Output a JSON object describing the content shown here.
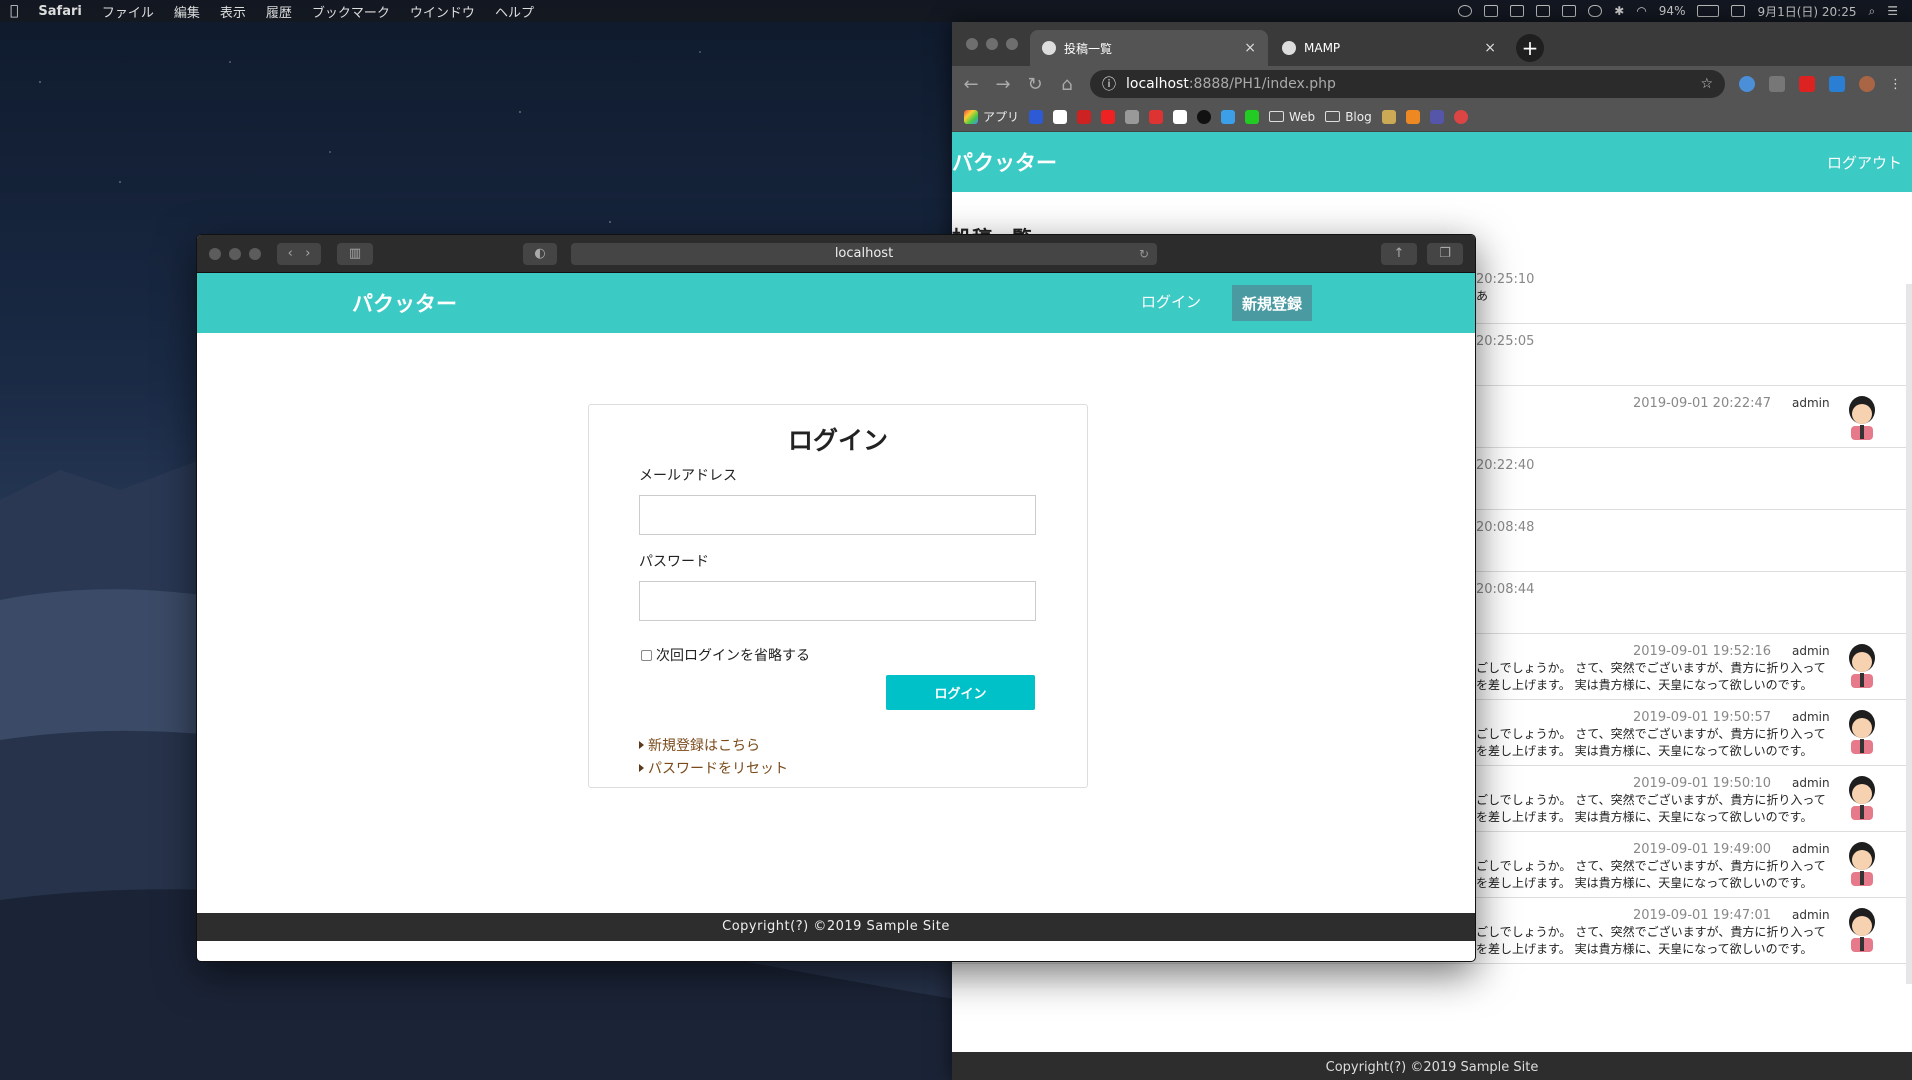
{
  "menubar": {
    "app": "Safari",
    "items": [
      "ファイル",
      "編集",
      "表示",
      "履歴",
      "ブックマーク",
      "ウインドウ",
      "ヘルプ"
    ],
    "battery": "94%",
    "clock": "9月1日(日)  20:25"
  },
  "chrome": {
    "tabs": [
      {
        "label": "投稿一覧",
        "active": true
      },
      {
        "label": "MAMP",
        "active": false
      }
    ],
    "url_host": "localhost",
    "url_path": ":8888/PH1/index.php",
    "bookmarks": {
      "apps": "アプリ",
      "web": "Web",
      "blog": "Blog"
    },
    "brand": "パクッター",
    "logout": "ログアウト",
    "list_title": "投稿一覧",
    "posts": [
      {
        "time": "20:25:10",
        "msg": "あ"
      },
      {
        "time": "20:25:05",
        "msg": ""
      },
      {
        "time": "2019-09-01 20:22:47",
        "user": "admin",
        "msg": ""
      },
      {
        "time": "20:22:40",
        "msg": ""
      },
      {
        "time": "20:08:48",
        "msg": ""
      },
      {
        "time": "20:08:44",
        "msg": ""
      },
      {
        "time": "2019-09-01 19:52:16",
        "user": "admin",
        "msg": "ごしでしょうか。 さて、突然でございますが、貴方に折り入って",
        "msg2": "を差し上げます。 実は貴方様に、天皇になって欲しいのです。"
      },
      {
        "time": "2019-09-01 19:50:57",
        "user": "admin",
        "msg": "ごしでしょうか。 さて、突然でございますが、貴方に折り入って",
        "msg2": "を差し上げます。 実は貴方様に、天皇になって欲しいのです。"
      },
      {
        "time": "2019-09-01 19:50:10",
        "user": "admin",
        "msg": "ごしでしょうか。 さて、突然でございますが、貴方に折り入って",
        "msg2": "を差し上げます。 実は貴方様に、天皇になって欲しいのです。"
      },
      {
        "time": "2019-09-01 19:49:00",
        "user": "admin",
        "msg": "ごしでしょうか。 さて、突然でございますが、貴方に折り入って",
        "msg2": "を差し上げます。 実は貴方様に、天皇になって欲しいのです。"
      },
      {
        "time": "2019-09-01 19:47:01",
        "user": "admin",
        "msg": "ごしでしょうか。 さて、突然でございますが、貴方に折り入って",
        "msg2": "を差し上げます。 実は貴方様に、天皇になって欲しいのです。"
      }
    ],
    "footer": "Copyright(?) ©2019 Sample Site"
  },
  "safari": {
    "url": "localhost",
    "brand": "パクッター",
    "nav_login": "ログイン",
    "nav_signup": "新規登録",
    "form": {
      "title": "ログイン",
      "email_label": "メールアドレス",
      "email_value": "",
      "password_label": "パスワード",
      "password_value": "",
      "remember_label": "次回ログインを省略する",
      "submit": "ログイン",
      "signup_link": "新規登録はこちら",
      "reset_link": "パスワードをリセット"
    },
    "footer": "Copyright(?) ©2019 Sample Site"
  },
  "colors": {
    "accent": "#3ccac5",
    "submit": "#00c0c8",
    "signup_btn": "#4a9aa1",
    "footer": "#2d2d2d"
  }
}
